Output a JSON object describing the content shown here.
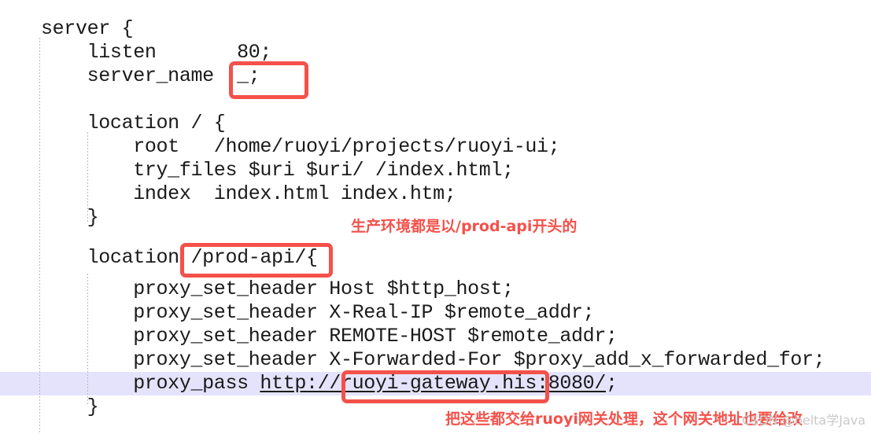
{
  "editor": {
    "language": "nginx-config",
    "background_color": "#ffffff",
    "text_color": "#1a1a1a",
    "current_line_highlight_color": "#e5e3fb",
    "indent_guide_color": "#b9b9b9",
    "annotation_color": "#f4514a"
  },
  "code": {
    "lines": [
      {
        "id": "l1",
        "text": "server {"
      },
      {
        "id": "l2",
        "text": "    listen       80;"
      },
      {
        "id": "l3",
        "text": "    server_name  _;"
      },
      {
        "id": "l4",
        "text": ""
      },
      {
        "id": "l5",
        "text": "    location / {"
      },
      {
        "id": "l6",
        "text": "        root   /home/ruoyi/projects/ruoyi-ui;"
      },
      {
        "id": "l7",
        "text": "        try_files $uri $uri/ /index.html;"
      },
      {
        "id": "l8",
        "text": "        index  index.html index.htm;"
      },
      {
        "id": "l9",
        "text": "    }"
      },
      {
        "id": "l10",
        "text": ""
      },
      {
        "id": "l11",
        "text": "    location /prod-api/{"
      },
      {
        "id": "l12",
        "text": "        proxy_set_header Host $http_host;"
      },
      {
        "id": "l13",
        "text": "        proxy_set_header X-Real-IP $remote_addr;"
      },
      {
        "id": "l14",
        "text": "        proxy_set_header REMOTE-HOST $remote_addr;"
      },
      {
        "id": "l15",
        "text": "        proxy_set_header X-Forwarded-For $proxy_add_x_forwarded_for;"
      },
      {
        "id": "l16",
        "prefix": "        proxy_pass ",
        "url": "http://ruoyi-gateway.his:8080/",
        "suffix": ";",
        "highlighted": true
      },
      {
        "id": "l17",
        "text": "    }"
      }
    ]
  },
  "annotations": {
    "boxes": [
      {
        "id": "box-server-name",
        "target": "_;"
      },
      {
        "id": "box-prod-api",
        "target": "/prod-api/{"
      },
      {
        "id": "box-gateway-host",
        "target": "ruoyi-gateway.his"
      }
    ],
    "notes": [
      {
        "id": "note-prod-api",
        "text": "生产环境都是以/prod-api开头的"
      },
      {
        "id": "note-gateway",
        "text": "把这些都交给ruoyi网关处理，这个网关地址也要给改"
      }
    ]
  },
  "watermark": {
    "text": "CSDN @belta学Java"
  }
}
